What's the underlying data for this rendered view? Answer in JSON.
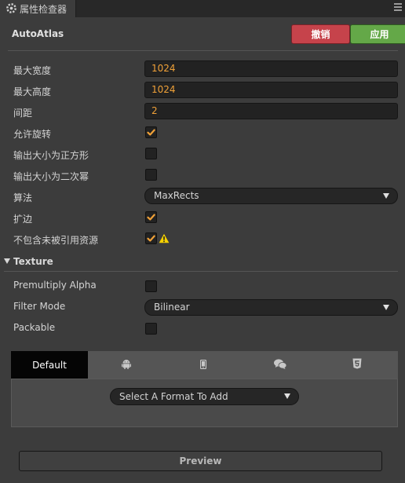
{
  "panel": {
    "tab_title": "属性检查器"
  },
  "component": {
    "title": "AutoAtlas",
    "revert_label": "撤销",
    "apply_label": "应用"
  },
  "fields": {
    "max_width": {
      "label": "最大宽度",
      "value": "1024"
    },
    "max_height": {
      "label": "最大高度",
      "value": "1024"
    },
    "padding": {
      "label": "间距",
      "value": "2"
    },
    "allow_rotation": {
      "label": "允许旋转",
      "checked": true
    },
    "force_squared": {
      "label": "输出大小为正方形",
      "checked": false
    },
    "power_of_two": {
      "label": "输出大小为二次幂",
      "checked": false
    },
    "algorithm": {
      "label": "算法",
      "value": "MaxRects"
    },
    "padding_bleed": {
      "label": "扩边",
      "checked": true
    },
    "filter_unused": {
      "label": "不包含未被引用资源",
      "checked": true,
      "warning": true
    }
  },
  "texture": {
    "section_label": "Texture",
    "premultiply_alpha": {
      "label": "Premultiply Alpha",
      "checked": false
    },
    "filter_mode": {
      "label": "Filter Mode",
      "value": "Bilinear"
    },
    "packable": {
      "label": "Packable",
      "checked": false
    }
  },
  "platforms": {
    "tabs": [
      {
        "label": "Default",
        "icon": "default",
        "active": true
      },
      {
        "label": "",
        "icon": "android-icon",
        "active": false
      },
      {
        "label": "",
        "icon": "mobile-phone-icon",
        "active": false
      },
      {
        "label": "",
        "icon": "wechat-icon",
        "active": false
      },
      {
        "label": "",
        "icon": "html5-icon",
        "active": false
      }
    ],
    "format_select": "Select A Format To Add"
  },
  "preview_label": "Preview",
  "colors": {
    "background": "#3c3c3c",
    "accent_orange": "#f0a138",
    "revert_red": "#c6434b",
    "apply_green": "#64a848",
    "warning_yellow": "#f5d000"
  }
}
